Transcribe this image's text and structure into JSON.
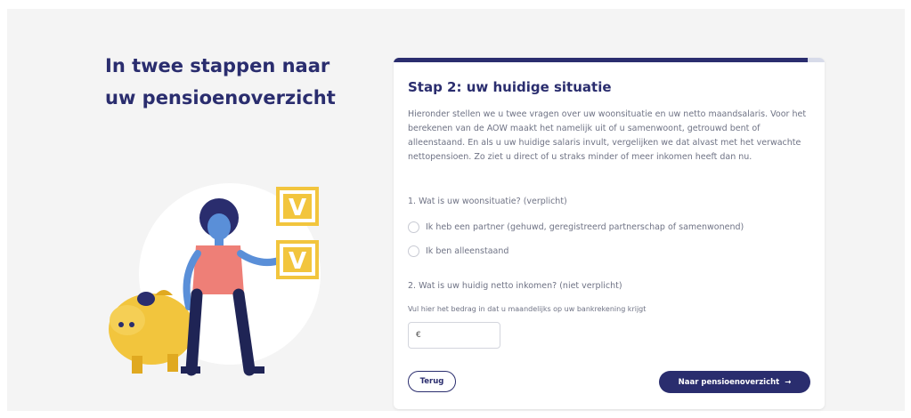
{
  "hero": {
    "title": "In twee stappen naar uw pensioenoverzicht"
  },
  "illustration": {
    "checkbox_glyph": "V"
  },
  "form": {
    "progress_percent": 96,
    "step_title": "Stap 2: uw huidige situatie",
    "intro": "Hieronder stellen we u twee vragen over uw woonsituatie en uw netto maandsalaris. Voor het berekenen van de AOW maakt het namelijk uit of u samenwoont, getrouwd bent of alleenstaand. En als u uw huidige salaris invult, vergelijken we dat alvast met het verwachte nettopensioen. Zo ziet u direct of u straks minder of meer inkomen heeft dan nu.",
    "question1": "1. Wat is uw woonsituatie? (verplicht)",
    "option_partner": "Ik heb een partner (gehuwd, geregistreerd partnerschap of samenwonend)",
    "option_single": "Ik ben alleenstaand",
    "question2": "2. Wat is uw huidig netto inkomen? (niet verplicht)",
    "income_hint": "Vul hier het bedrag in dat u maandelijks op uw bankrekening krijgt",
    "currency_symbol": "€",
    "income_value": "",
    "back_label": "Terug",
    "next_label": "Naar pensioenoverzicht",
    "next_arrow": "→"
  },
  "colors": {
    "brand_navy": "#2a2d6e",
    "accent_yellow": "#f2c53d",
    "background": "#f4f4f4"
  }
}
